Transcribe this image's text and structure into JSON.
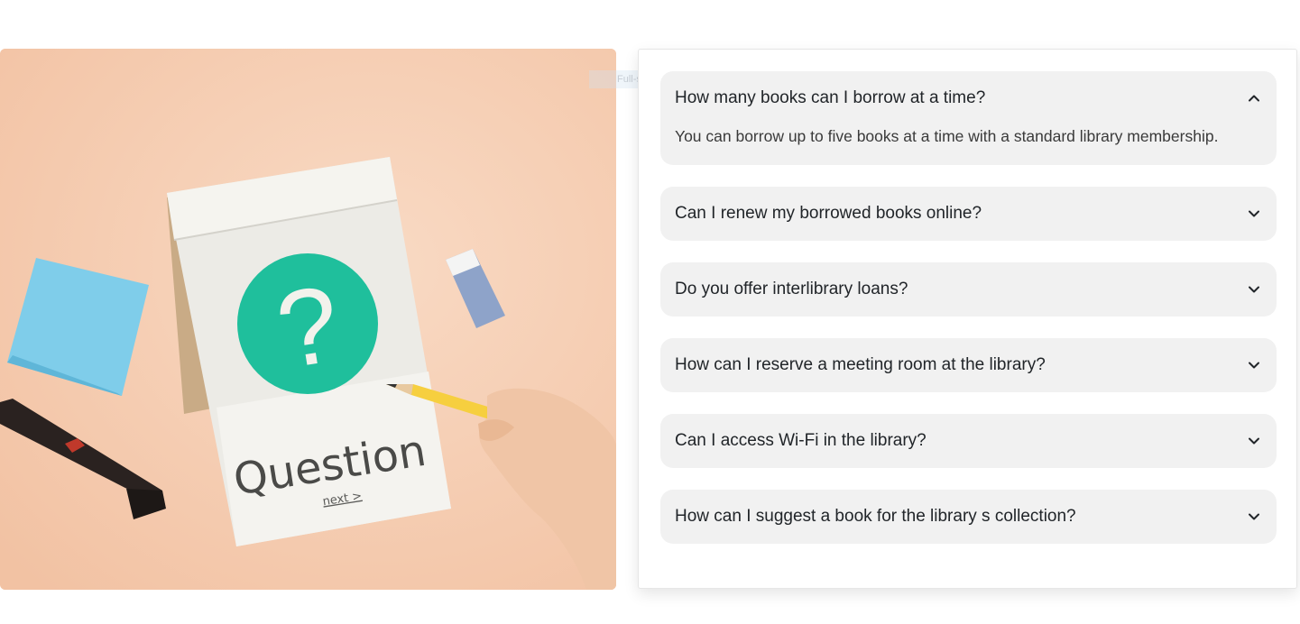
{
  "hero": {
    "title_word": "Question",
    "next_link": "next >",
    "symbol": "?"
  },
  "snip_ghost": "Full-screen Snip",
  "faq": {
    "items": [
      {
        "question": "How many books can I borrow at a time?",
        "answer": "You can borrow up to five books at a time with a standard library membership.",
        "expanded": true
      },
      {
        "question": "Can I renew my borrowed books online?",
        "expanded": false
      },
      {
        "question": "Do you offer interlibrary loans?",
        "expanded": false
      },
      {
        "question": "How can I reserve a meeting room at the library?",
        "expanded": false
      },
      {
        "question": "Can I access Wi-Fi in the library?",
        "expanded": false
      },
      {
        "question": "How can I suggest a book for the library s collection?",
        "expanded": false
      }
    ]
  },
  "icons": {
    "expanded": "chevron-up-icon",
    "collapsed": "chevron-down-icon"
  },
  "colors": {
    "item_background": "#f1f1f1",
    "hero_background": "#f6cdb0",
    "accent_teal": "#1fbf9c"
  }
}
